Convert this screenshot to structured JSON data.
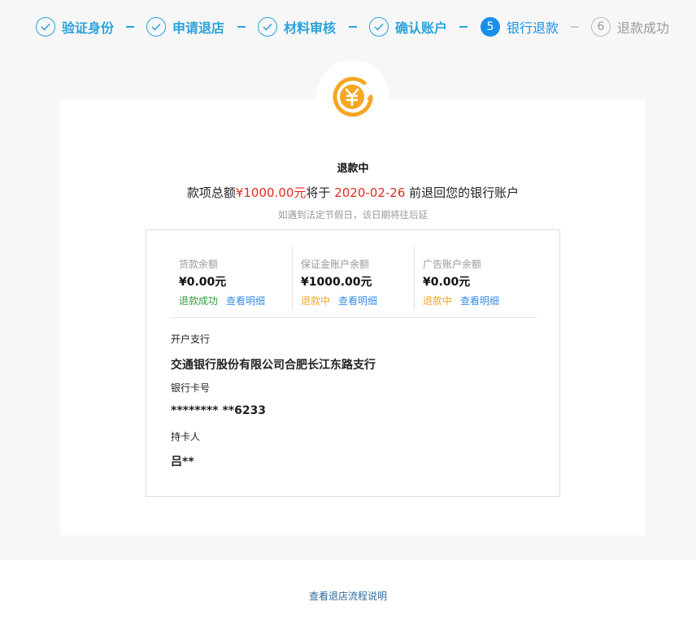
{
  "steps": [
    {
      "num": "✓",
      "label": "验证身份",
      "state": "done"
    },
    {
      "num": "✓",
      "label": "申请退店",
      "state": "done"
    },
    {
      "num": "✓",
      "label": "材料审核",
      "state": "done"
    },
    {
      "num": "✓",
      "label": "确认账户",
      "state": "done"
    },
    {
      "num": "5",
      "label": "银行退款",
      "state": "active"
    },
    {
      "num": "6",
      "label": "退款成功",
      "state": "todo"
    }
  ],
  "colors": {
    "done": "#2aa3dc",
    "active": "#1890e8",
    "icon_orange": "#f5a623",
    "amount_red": "#e02b1f",
    "success_green": "#2e9e3a",
    "pending_orange": "#f5a623",
    "link_blue": "#3a8ee6"
  },
  "status": {
    "title": "退款中",
    "line_prefix": "款项总额",
    "amount": "¥1000.00元",
    "line_mid": "将于 ",
    "date": "2020-02-26",
    "line_suffix": " 前退回您的银行账户",
    "hint": "如遇到法定节假日，该日期将往后延"
  },
  "balances": [
    {
      "label": "货款余额",
      "value": "¥0.00元",
      "status": "退款成功",
      "status_type": "success",
      "link": "查看明细"
    },
    {
      "label": "保证金账户余额",
      "value": "¥1000.00元",
      "status": "退款中",
      "status_type": "pending",
      "link": "查看明细"
    },
    {
      "label": "广告账户余额",
      "value": "¥0.00元",
      "status": "退款中",
      "status_type": "pending",
      "link": "查看明细"
    }
  ],
  "account": {
    "bank_label": "开户支行",
    "bank_value": "交通银行股份有限公司合肥长江东路支行",
    "card_label": "银行卡号",
    "card_value": "******** **6233",
    "holder_label": "持卡人",
    "holder_value": "吕**"
  },
  "footer": {
    "link": "查看退店流程说明"
  }
}
